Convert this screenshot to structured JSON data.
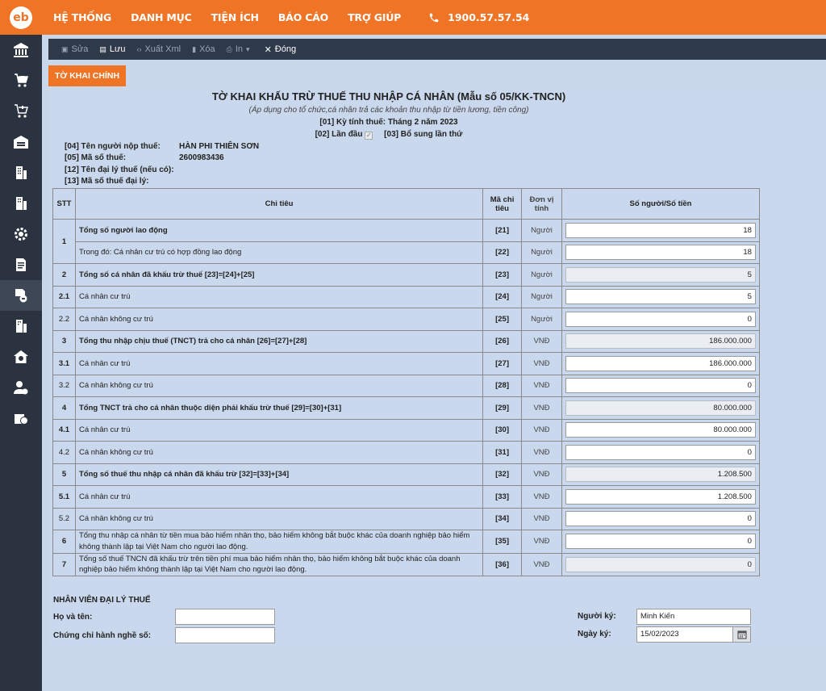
{
  "brand": {
    "logo_text": "eb",
    "accent": "#ef7426"
  },
  "menu": [
    "HỆ THỐNG",
    "DANH MỤC",
    "TIỆN ÍCH",
    "BÁO CÁO",
    "TRỢ GIÚP"
  ],
  "hotline": "1900.57.57.54",
  "toolbar": {
    "edit": "Sửa",
    "save": "Lưu",
    "export": "Xuất Xml",
    "delete": "Xóa",
    "print": "In",
    "close": "Đóng"
  },
  "tab": "TỜ KHAI CHÍNH",
  "form": {
    "title": "TỜ KHAI KHẤU TRỪ THUẾ THU NHẬP CÁ NHÂN (Mẫu số 05/KK-TNCN)",
    "subtitle": "(Áp dụng cho tổ chức,cá nhân trả các khoản thu nhập từ tiền lương, tiền công)",
    "period": "[01] Kỳ tính thuế: Tháng 2 năm 2023",
    "first_time": "[02] Lần đầu",
    "supplement": "[03] Bổ sung lần thứ"
  },
  "taxpayer": {
    "name_label": "[04] Tên người nộp thuế:",
    "name": "HÀN PHI THIÊN SƠN",
    "tax_code_label": "[05] Mã số thuế:",
    "tax_code": "2600983436",
    "agent_name_label": "[12] Tên đại lý thuế (nếu có):",
    "agent_code_label": "[13] Mã số thuế đại lý:"
  },
  "table": {
    "headers": {
      "stt": "STT",
      "chitieu": "Chỉ tiêu",
      "ma": "Mã chỉ tiêu",
      "dv": "Đơn vị tính",
      "val": "Số người/Số tiền"
    },
    "rows": [
      {
        "stt": "1",
        "label": "Tổng số người lao động",
        "code": "[21]",
        "unit": "Người",
        "value": "18"
      },
      {
        "stt": "",
        "label": "Trong đó: Cá nhân cư trú có hợp đồng lao động",
        "code": "[22]",
        "unit": "Người",
        "value": "18"
      },
      {
        "stt": "2",
        "label": "Tổng số cá nhân đã khấu trừ thuế [23]=[24]+[25]",
        "code": "[23]",
        "unit": "Người",
        "value": "5"
      },
      {
        "stt": "2.1",
        "label": "Cá nhân cư trú",
        "code": "[24]",
        "unit": "Người",
        "value": "5"
      },
      {
        "stt": "2.2",
        "label": "Cá nhân không cư trú",
        "code": "[25]",
        "unit": "Người",
        "value": "0"
      },
      {
        "stt": "3",
        "label": "Tổng thu nhập chịu thuế (TNCT) trả cho cá nhân [26]=[27]+[28]",
        "code": "[26]",
        "unit": "VNĐ",
        "value": "186.000.000"
      },
      {
        "stt": "3.1",
        "label": "Cá nhân cư trú",
        "code": "[27]",
        "unit": "VNĐ",
        "value": "186.000.000"
      },
      {
        "stt": "3.2",
        "label": "Cá nhân không cư trú",
        "code": "[28]",
        "unit": "VNĐ",
        "value": "0"
      },
      {
        "stt": "4",
        "label": "Tổng TNCT trả cho cá nhân thuộc diện phải khấu trừ thuế [29]=[30]+[31]",
        "code": "[29]",
        "unit": "VNĐ",
        "value": "80.000.000"
      },
      {
        "stt": "4.1",
        "label": "Cá nhân cư trú",
        "code": "[30]",
        "unit": "VNĐ",
        "value": "80.000.000"
      },
      {
        "stt": "4.2",
        "label": "Cá nhân không cư trú",
        "code": "[31]",
        "unit": "VNĐ",
        "value": "0"
      },
      {
        "stt": "5",
        "label": "Tổng số thuế thu nhập cá nhân đã khấu trừ [32]=[33]+[34]",
        "code": "[32]",
        "unit": "VNĐ",
        "value": "1.208.500"
      },
      {
        "stt": "5.1",
        "label": "Cá nhân cư trú",
        "code": "[33]",
        "unit": "VNĐ",
        "value": "1.208.500"
      },
      {
        "stt": "5.2",
        "label": "Cá nhân không cư trú",
        "code": "[34]",
        "unit": "VNĐ",
        "value": "0"
      },
      {
        "stt": "6",
        "label": "Tổng thu nhập cá nhân từ tiền mua bảo hiểm nhân thọ, bảo hiểm không bắt buộc khác của doanh nghiệp bảo hiểm không thành lập tại Việt Nam cho người lao động.",
        "code": "[35]",
        "unit": "VNĐ",
        "value": "0"
      },
      {
        "stt": "7",
        "label": "Tổng số thuế TNCN đã khấu trừ trên tiền phí mua bảo hiểm nhân thọ, bảo hiểm không bắt buộc khác của doanh nghiệp bảo hiểm không thành lập tại Việt Nam cho người lao động.",
        "code": "[36]",
        "unit": "VNĐ",
        "value": "0"
      }
    ]
  },
  "agent": {
    "section": "NHÂN VIÊN ĐẠI LÝ THUẾ",
    "name_label": "Họ và tên:",
    "cert_label": "Chứng chỉ hành nghề số:",
    "signer_label": "Người ký:",
    "signer": "Minh Kiến",
    "date_label": "Ngày ký:",
    "date": "15/02/2023"
  }
}
